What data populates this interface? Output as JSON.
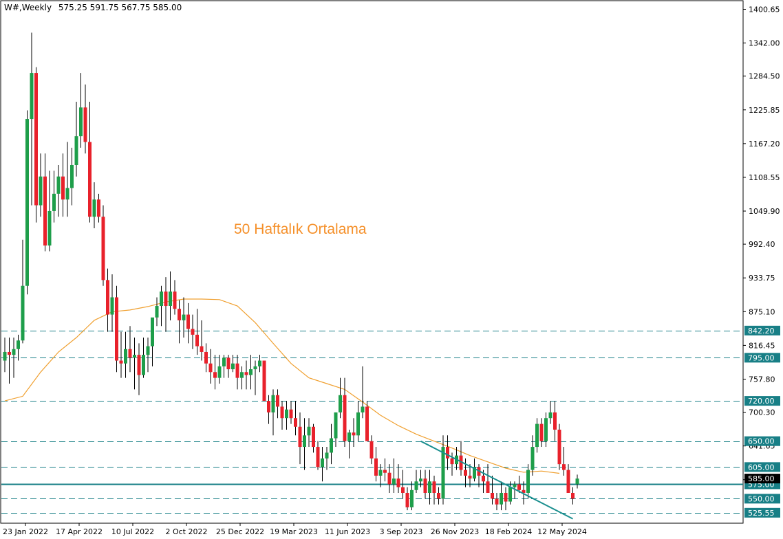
{
  "header": {
    "symbol": "W#,Weekly",
    "ohlc": "575.25 591.75 567.75 585.00"
  },
  "colors": {
    "up": "#1e9e4a",
    "down": "#e8212b",
    "wick": "#000000",
    "ma": "#f0a030",
    "levels": "#187f86",
    "trendline": "#1a8f8f",
    "annotation": "#f5902a",
    "price_tag": "#000000"
  },
  "chart_data": {
    "type": "candlestick",
    "title": "W#,Weekly",
    "ylim": [
      511,
      1412
    ],
    "y_ticks": [
      "1400.65",
      "1342.00",
      "1284.50",
      "1225.85",
      "1167.20",
      "1108.55",
      "1049.90",
      "992.40",
      "933.75",
      "875.10",
      "816.45",
      "757.80",
      "700.30",
      "641.65",
      "583.00"
    ],
    "x_ticks": [
      {
        "label": "23 Jan 2022",
        "index": 0
      },
      {
        "label": "17 Apr 2022",
        "index": 12
      },
      {
        "label": "10 Jul 2022",
        "index": 24
      },
      {
        "label": "2 Oct 2022",
        "index": 36
      },
      {
        "label": "25 Dec 2022",
        "index": 48
      },
      {
        "label": "19 Mar 2023",
        "index": 60
      },
      {
        "label": "11 Jun 2023",
        "index": 72
      },
      {
        "label": "3 Sep 2023",
        "index": 84
      },
      {
        "label": "26 Nov 2023",
        "index": 96
      },
      {
        "label": "18 Feb 2024",
        "index": 108
      },
      {
        "label": "12 May 2024",
        "index": 120
      }
    ],
    "candles": [
      [
        790,
        830,
        770,
        805
      ],
      [
        805,
        830,
        750,
        800
      ],
      [
        800,
        830,
        760,
        810
      ],
      [
        810,
        835,
        790,
        825
      ],
      [
        825,
        1000,
        820,
        920
      ],
      [
        920,
        1225,
        905,
        1210
      ],
      [
        1210,
        1360,
        1060,
        1290
      ],
      [
        1290,
        1300,
        1030,
        1060
      ],
      [
        1060,
        1150,
        1040,
        1110
      ],
      [
        1110,
        1150,
        980,
        990
      ],
      [
        990,
        1120,
        980,
        1050
      ],
      [
        1050,
        1120,
        1030,
        1080
      ],
      [
        1080,
        1130,
        1040,
        1110
      ],
      [
        1110,
        1150,
        1040,
        1070
      ],
      [
        1070,
        1170,
        1040,
        1090
      ],
      [
        1090,
        1160,
        1060,
        1130
      ],
      [
        1130,
        1240,
        1110,
        1180
      ],
      [
        1180,
        1290,
        1160,
        1230
      ],
      [
        1230,
        1270,
        1150,
        1170
      ],
      [
        1170,
        1240,
        1030,
        1040
      ],
      [
        1040,
        1100,
        1020,
        1070
      ],
      [
        1070,
        1080,
        1030,
        1040
      ],
      [
        1040,
        1060,
        920,
        930
      ],
      [
        930,
        950,
        840,
        870
      ],
      [
        870,
        940,
        840,
        900
      ],
      [
        900,
        920,
        770,
        790
      ],
      [
        790,
        840,
        760,
        785
      ],
      [
        785,
        840,
        760,
        810
      ],
      [
        810,
        850,
        770,
        795
      ],
      [
        795,
        830,
        740,
        800
      ],
      [
        800,
        820,
        730,
        765
      ],
      [
        765,
        830,
        760,
        800
      ],
      [
        800,
        830,
        770,
        815
      ],
      [
        815,
        860,
        780,
        865
      ],
      [
        865,
        900,
        850,
        885
      ],
      [
        885,
        920,
        850,
        910
      ],
      [
        910,
        935,
        840,
        885
      ],
      [
        885,
        945,
        860,
        910
      ],
      [
        910,
        930,
        870,
        880
      ],
      [
        880,
        895,
        820,
        860
      ],
      [
        860,
        900,
        830,
        870
      ],
      [
        870,
        890,
        820,
        845
      ],
      [
        845,
        870,
        810,
        835
      ],
      [
        835,
        880,
        800,
        815
      ],
      [
        815,
        860,
        790,
        805
      ],
      [
        805,
        820,
        770,
        785
      ],
      [
        785,
        810,
        750,
        770
      ],
      [
        770,
        800,
        740,
        760
      ],
      [
        760,
        800,
        750,
        780
      ],
      [
        780,
        800,
        760,
        795
      ],
      [
        795,
        800,
        760,
        775
      ],
      [
        775,
        800,
        770,
        785
      ],
      [
        785,
        800,
        740,
        760
      ],
      [
        760,
        780,
        740,
        770
      ],
      [
        770,
        790,
        740,
        765
      ],
      [
        765,
        800,
        740,
        775
      ],
      [
        775,
        790,
        730,
        780
      ],
      [
        780,
        800,
        770,
        790
      ],
      [
        790,
        790,
        720,
        720
      ],
      [
        720,
        730,
        680,
        700
      ],
      [
        700,
        740,
        660,
        730
      ],
      [
        730,
        740,
        690,
        710
      ],
      [
        710,
        720,
        670,
        690
      ],
      [
        690,
        720,
        670,
        705
      ],
      [
        705,
        720,
        680,
        690
      ],
      [
        690,
        720,
        660,
        675
      ],
      [
        675,
        700,
        610,
        640
      ],
      [
        640,
        690,
        600,
        660
      ],
      [
        660,
        690,
        640,
        675
      ],
      [
        675,
        680,
        630,
        640
      ],
      [
        640,
        650,
        600,
        605
      ],
      [
        605,
        640,
        580,
        620
      ],
      [
        620,
        640,
        600,
        630
      ],
      [
        630,
        680,
        610,
        655
      ],
      [
        655,
        700,
        640,
        700
      ],
      [
        700,
        760,
        690,
        730
      ],
      [
        730,
        760,
        640,
        650
      ],
      [
        650,
        670,
        620,
        665
      ],
      [
        665,
        690,
        640,
        660
      ],
      [
        660,
        720,
        650,
        700
      ],
      [
        700,
        780,
        690,
        710
      ],
      [
        710,
        720,
        650,
        650
      ],
      [
        650,
        660,
        610,
        620
      ],
      [
        620,
        640,
        580,
        590
      ],
      [
        590,
        610,
        570,
        600
      ],
      [
        600,
        620,
        580,
        595
      ],
      [
        595,
        610,
        560,
        575
      ],
      [
        575,
        620,
        560,
        585
      ],
      [
        585,
        610,
        560,
        570
      ],
      [
        570,
        600,
        550,
        560
      ],
      [
        560,
        570,
        530,
        535
      ],
      [
        535,
        580,
        530,
        565
      ],
      [
        565,
        600,
        560,
        580
      ],
      [
        580,
        600,
        570,
        585
      ],
      [
        585,
        600,
        550,
        560
      ],
      [
        560,
        600,
        540,
        580
      ],
      [
        580,
        590,
        540,
        560
      ],
      [
        560,
        570,
        540,
        550
      ],
      [
        550,
        660,
        540,
        640
      ],
      [
        640,
        660,
        600,
        620
      ],
      [
        620,
        630,
        590,
        610
      ],
      [
        610,
        640,
        600,
        625
      ],
      [
        625,
        650,
        590,
        600
      ],
      [
        600,
        620,
        570,
        590
      ],
      [
        590,
        610,
        570,
        585
      ],
      [
        585,
        620,
        580,
        605
      ],
      [
        605,
        610,
        570,
        590
      ],
      [
        590,
        600,
        560,
        580
      ],
      [
        580,
        610,
        560,
        560
      ],
      [
        560,
        590,
        540,
        550
      ],
      [
        550,
        560,
        530,
        540
      ],
      [
        540,
        580,
        530,
        560
      ],
      [
        560,
        570,
        530,
        545
      ],
      [
        545,
        580,
        540,
        570
      ],
      [
        570,
        580,
        550,
        575
      ],
      [
        575,
        590,
        560,
        565
      ],
      [
        565,
        580,
        540,
        560
      ],
      [
        560,
        610,
        550,
        600
      ],
      [
        600,
        660,
        590,
        640
      ],
      [
        640,
        690,
        630,
        680
      ],
      [
        680,
        690,
        640,
        650
      ],
      [
        650,
        700,
        640,
        690
      ],
      [
        690,
        720,
        680,
        700
      ],
      [
        700,
        720,
        650,
        670
      ],
      [
        670,
        680,
        600,
        610
      ],
      [
        610,
        640,
        590,
        600
      ],
      [
        600,
        610,
        560,
        560
      ],
      [
        560,
        570,
        540,
        550
      ],
      [
        575.25,
        591.75,
        567.75,
        585
      ]
    ],
    "moving_average": {
      "name": "50 Haftalık Ortalama",
      "period": 50,
      "points": [
        [
          0,
          720
        ],
        [
          4,
          728
        ],
        [
          8,
          770
        ],
        [
          12,
          805
        ],
        [
          16,
          830
        ],
        [
          20,
          860
        ],
        [
          24,
          875
        ],
        [
          28,
          878
        ],
        [
          32,
          884
        ],
        [
          36,
          892
        ],
        [
          40,
          897
        ],
        [
          44,
          897
        ],
        [
          48,
          896
        ],
        [
          52,
          885
        ],
        [
          56,
          856
        ],
        [
          60,
          820
        ],
        [
          64,
          785
        ],
        [
          68,
          760
        ],
        [
          72,
          750
        ],
        [
          76,
          740
        ],
        [
          80,
          718
        ],
        [
          84,
          695
        ],
        [
          88,
          677
        ],
        [
          92,
          662
        ],
        [
          96,
          650
        ],
        [
          100,
          638
        ],
        [
          104,
          625
        ],
        [
          108,
          614
        ],
        [
          112,
          603
        ],
        [
          116,
          596
        ],
        [
          120,
          598
        ],
        [
          124,
          594
        ]
      ]
    },
    "horizontal_levels": [
      "842.20",
      "795.00",
      "720.00",
      "650.00",
      "605.00",
      "575.00",
      "550.00",
      "525.55"
    ],
    "solid_level": "575.00",
    "current_price": "585.00",
    "trendline": {
      "start": {
        "index": 93,
        "price": 650
      },
      "end": {
        "index": 127,
        "price": 515
      }
    },
    "annotation": "50 Haftalık Ortalama"
  }
}
